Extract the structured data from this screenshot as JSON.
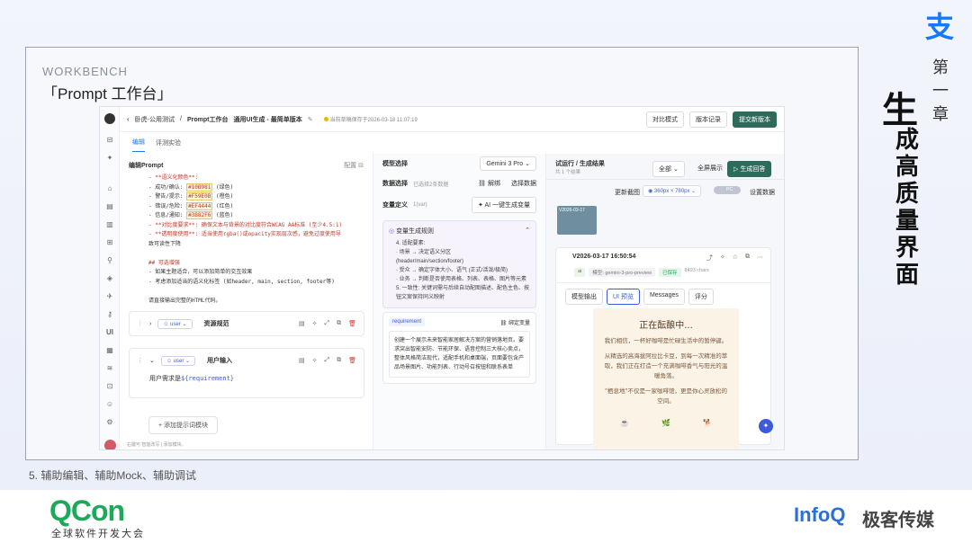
{
  "slide": {
    "workbench_title": "WORKBENCH",
    "workbench_subtitle": "「Prompt 工作台」",
    "caption": "5. 辅助编辑、辅助Mock、辅助调试",
    "chapter_label": "第一章",
    "vertical_big": "生",
    "vertical_title": "成高质量界面",
    "alipay_glyph": "支",
    "qcon_logo": "QCon",
    "qcon_subtitle": "全球软件开发大会",
    "infoq_logo": "InfoQ",
    "infoq_cn": "极客传媒"
  },
  "app": {
    "breadcrumb": [
      "卧虎-公用测试",
      "Prompt工作台",
      "通用UI生成 - 最简单版本"
    ],
    "save_status": "当前草稿保存于2026-03-18 11:07:19",
    "top_buttons": [
      "对比模式",
      "版本记录",
      "提交新版本"
    ],
    "tabs": [
      "编辑",
      "评测实验"
    ],
    "left": {
      "header": "编辑Prompt",
      "config_label": "配置",
      "code_lines": [
        {
          "t": "- **语义化颜色**:",
          "c": ""
        },
        {
          "t": "- 成功/确认: ",
          "c": "#10B981",
          "e": " (绿色)"
        },
        {
          "t": "- 警告/提示: ",
          "c": "#F59E0B",
          "e": " (橙色)"
        },
        {
          "t": "- 错误/危险: ",
          "c": "#EF4444",
          "e": " (红色)"
        },
        {
          "t": "- 信息/通知: ",
          "c": "#3B82F6",
          "e": " (蓝色)"
        },
        {
          "t": "- **对比度要求**: 确保文本与背景的对比度符合WCAG AA标准 (至少4.5:1)",
          "c": ""
        },
        {
          "t": "- **透明度使用**: 适当使用rgba()或opacity实现层次感，避免过度使用导",
          "c": ""
        },
        {
          "t": "致可读性下降",
          "c": ""
        },
        {
          "t": "",
          "c": ""
        },
        {
          "t": "## 可选增强",
          "c": ""
        },
        {
          "t": "- 如果主题适合，可以添加简单的交互效果",
          "c": ""
        },
        {
          "t": "- 考虑添加适当的语义化标签 (如header, main, section, footer等)",
          "c": ""
        },
        {
          "t": "",
          "c": ""
        },
        {
          "t": "请直接输出完整的HTML代码。",
          "c": ""
        }
      ],
      "block1": {
        "role": "user",
        "title": "资源规范"
      },
      "block2": {
        "role": "user",
        "title": "用户输入",
        "body_prefix": "用户需求是",
        "body_var": "${requirement}"
      },
      "add_button": "+ 添加提示词模块",
      "footer_hint": "右键可 智能改写 | 添加模块。"
    },
    "middle": {
      "model_label": "模型选择",
      "model_selected": "Gemini 3 Pro",
      "data_label": "数据选择",
      "data_sub": "已选择2条数据",
      "unbind": "解绑",
      "select_data": "选择数据",
      "var_def": "变量定义",
      "var_count": "1(var)",
      "ai_button": "AI 一键生成变量",
      "rule_title": "变量生成规则",
      "rules": [
        "4. 适配要素:",
        "  · 场景 → 决定语义分区",
        "  (header/main/section/footer)",
        "  · 受众 → 确定字体大小、语气 (正式/活泼/极简)",
        "  · 业务 → 判断是否使用表格、列表、表格、图片等元素",
        "5. 一致性: 关键词需与后续自动配图描述、配色主色、按",
        "  钮文案保持同义映射"
      ],
      "var_name": "requirement",
      "bind_var": "绑定变量",
      "var_value": "创建一个展示未来智能家居解决方案的营销落地页。要求突出智能安防、节能环保、语音控制三大核心卖点，整体风格简洁现代，适配手机和桌面端，页面要包含产品场景图片、功能列表、行动号召按钮和联系表单"
    },
    "right": {
      "header": "试运行 / 生成结果",
      "sub": "共 1 个结果",
      "filter": "全部",
      "fullscreen": "全屏展示",
      "generate": "生成回答",
      "refresh": "更新截图",
      "size": "360px × 780px",
      "pc": "PC",
      "settings": "设置数据",
      "thumb_label": "V2026-03-17",
      "version": "V2026-03-17 16:50:54",
      "ai_tag": "ai",
      "model_tag": "模型: gemini-3-pro-preview",
      "status_tag": "已保存",
      "chars": "8493 chars",
      "result_tabs": [
        "模型输出",
        "UI 预览",
        "Messages",
        "评分"
      ],
      "preview_title": "正在酝酿中...",
      "preview_p1": "我们相信，一杯好咖啡是忙碌生活中的暂停键。",
      "preview_p2": "从精选的高海拔阿拉比卡豆，到每一次精准的萃取，我们正在打造一个充满咖啡香气与阳光的温暖角落。",
      "preview_p3": "\"栖息地\"不仅是一家咖啡馆，更是你心灵放松的空间。",
      "preview_icons": [
        "☕",
        "🌿",
        "🐕"
      ]
    },
    "accent": "#1677ff",
    "primary_dark": "#2f6b5c"
  }
}
